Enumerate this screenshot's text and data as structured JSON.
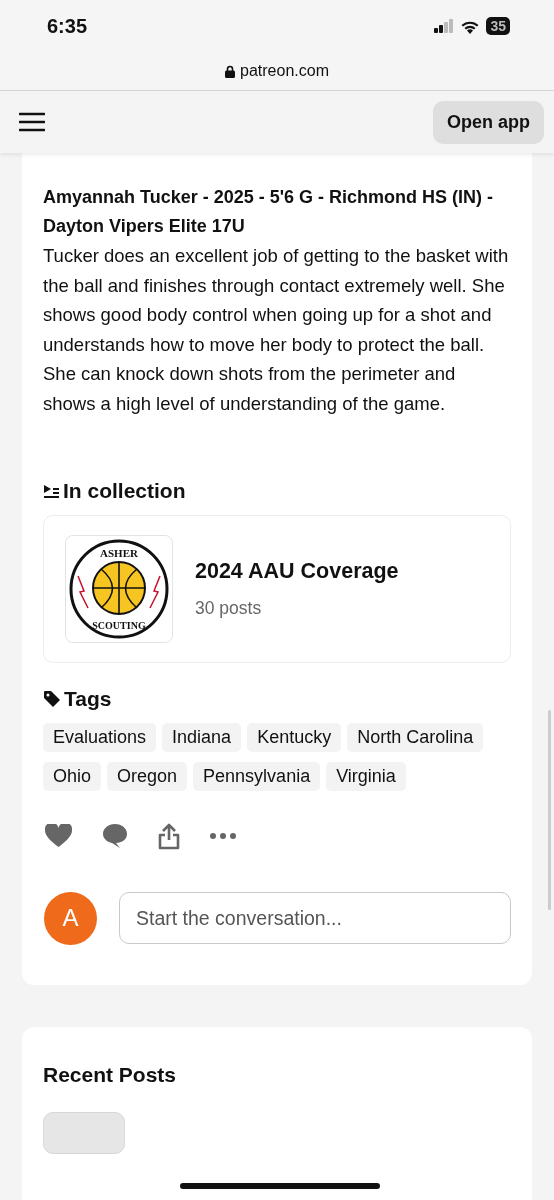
{
  "status_bar": {
    "time": "6:35",
    "battery": "35"
  },
  "browser": {
    "url": "patreon.com"
  },
  "header": {
    "open_app": "Open app"
  },
  "post": {
    "heading": "Amyannah Tucker - 2025 - 5'6 G - Richmond HS (IN) - Dayton Vipers Elite 17U",
    "body": "Tucker does an excellent job of getting to the basket with the ball and finishes through contact extremely well. She shows good body control when going up for a shot and understands how to move her body to protect the ball. She can knock down shots from the perimeter and shows a high level of understanding of the game."
  },
  "collection": {
    "heading": "In collection",
    "logo_top": "ASHER",
    "logo_bottom": "SCOUTING",
    "title": "2024 AAU Coverage",
    "count": "30 posts"
  },
  "tags": {
    "heading": "Tags",
    "items": [
      "Evaluations",
      "Indiana",
      "Kentucky",
      "North Carolina",
      "Ohio",
      "Oregon",
      "Pennsylvania",
      "Virginia"
    ]
  },
  "comment": {
    "avatar": "A",
    "placeholder": "Start the conversation..."
  },
  "recent": {
    "heading": "Recent Posts"
  }
}
